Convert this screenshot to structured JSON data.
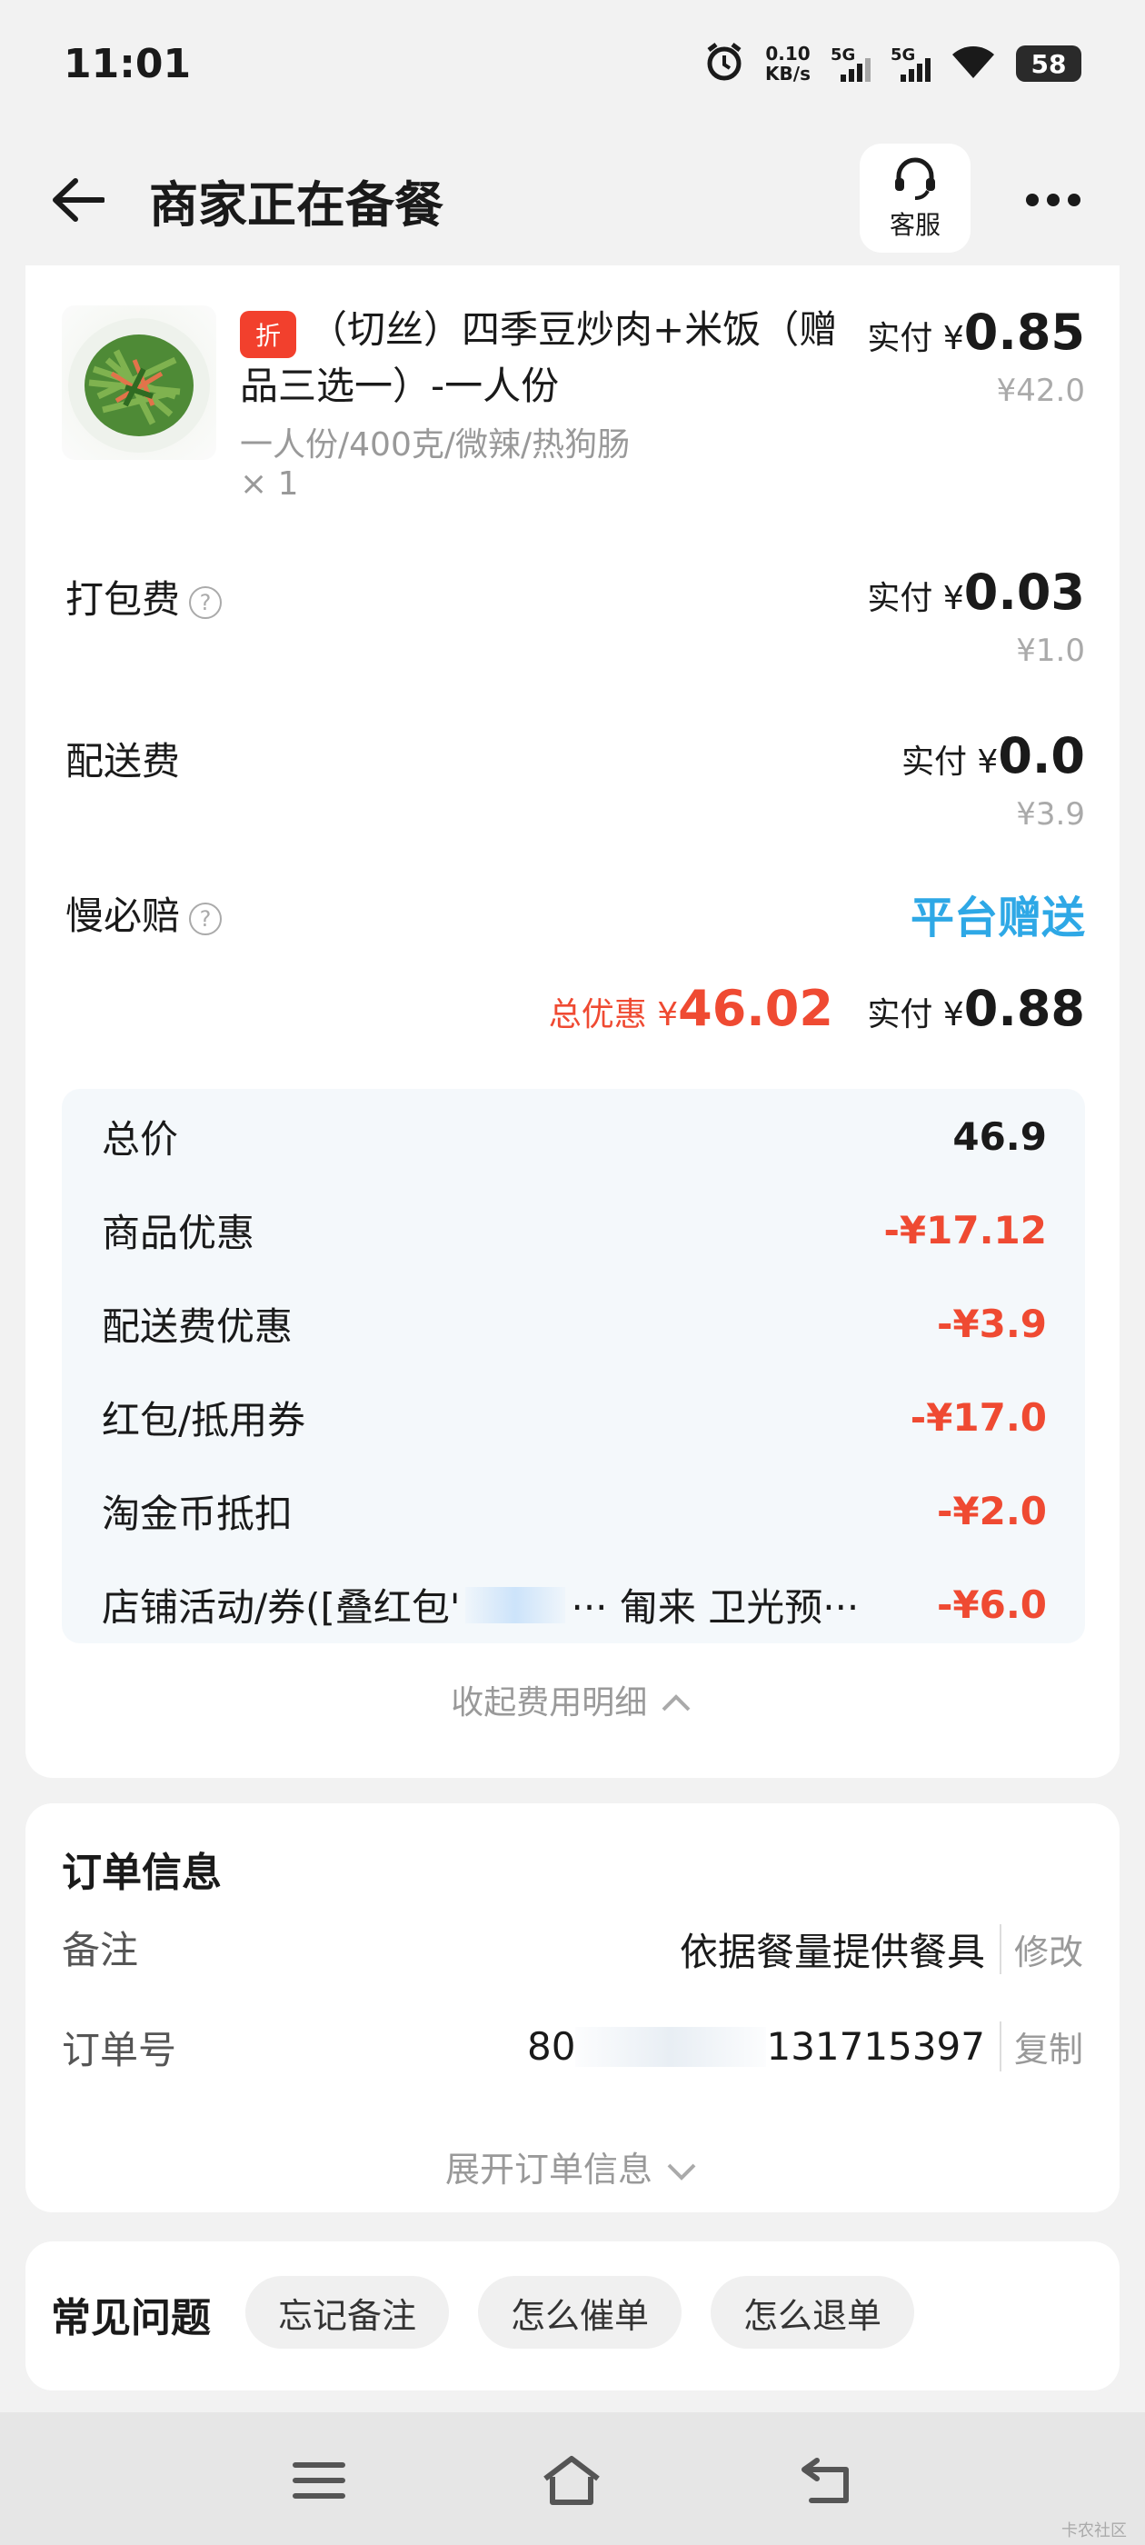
{
  "status_bar": {
    "time": "11:01",
    "speed_value": "0.10",
    "speed_unit": "KB/s",
    "network1": "5G",
    "network2": "5G",
    "battery": "58"
  },
  "header": {
    "title": "商家正在备餐",
    "service_label": "客服"
  },
  "product": {
    "badge": "折",
    "name": "（切丝）四季豆炒肉+米饭（赠品三选一）-一人份",
    "spec": "一人份/400克/微辣/热狗肠",
    "qty": "× 1",
    "paid_prefix": "实付 ¥",
    "paid": "0.85",
    "original": "¥42.0"
  },
  "fees": {
    "packing_label": "打包费",
    "packing_paid_prefix": "实付 ¥",
    "packing_paid": "0.03",
    "packing_original": "¥1.0",
    "delivery_label": "配送费",
    "delivery_paid_prefix": "实付 ¥",
    "delivery_paid": "0.0",
    "delivery_original": "¥3.9",
    "late_label": "慢必赔",
    "late_value": "平台赠送",
    "total_discount_label": "总优惠 ¥",
    "total_discount": "46.02",
    "total_paid_prefix": "实付 ¥",
    "total_paid": "0.88"
  },
  "breakdown": [
    {
      "label": "总价",
      "value": "46.9"
    },
    {
      "label": "商品优惠",
      "value": "-¥17.12"
    },
    {
      "label": "配送费优惠",
      "value": "-¥3.9"
    },
    {
      "label": "红包/抵用券",
      "value": "-¥17.0"
    },
    {
      "label": "淘金币抵扣",
      "value": "-¥2.0"
    },
    {
      "label": "店铺活动/券([叠红包'",
      "label_tail": "··· 匍来  卫光预···",
      "value": "-¥6.0"
    }
  ],
  "collapse_label": "收起费用明细",
  "order_info": {
    "title": "订单信息",
    "remark_label": "备注",
    "remark_value": "依据餐量提供餐具",
    "remark_action": "修改",
    "order_no_label": "订单号",
    "order_no_start": "80",
    "order_no_end": "131715397",
    "order_no_action": "复制",
    "expand_label": "展开订单信息"
  },
  "faq": {
    "title": "常见问题",
    "chips": [
      "忘记备注",
      "怎么催单",
      "怎么退单"
    ]
  },
  "watermark": "卡农社区"
}
